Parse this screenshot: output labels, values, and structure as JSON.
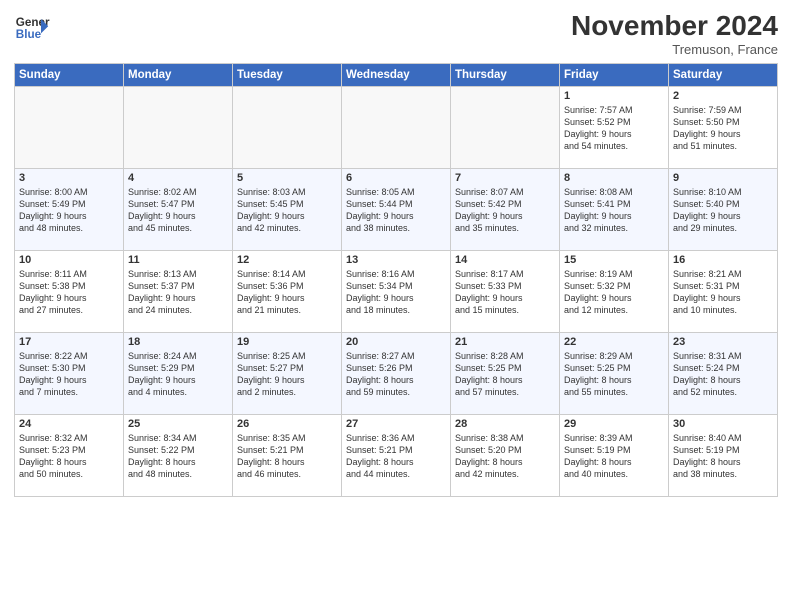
{
  "header": {
    "logo_line1": "General",
    "logo_line2": "Blue",
    "title": "November 2024",
    "location": "Tremuson, France"
  },
  "days_of_week": [
    "Sunday",
    "Monday",
    "Tuesday",
    "Wednesday",
    "Thursday",
    "Friday",
    "Saturday"
  ],
  "weeks": [
    [
      {
        "day": "",
        "info": ""
      },
      {
        "day": "",
        "info": ""
      },
      {
        "day": "",
        "info": ""
      },
      {
        "day": "",
        "info": ""
      },
      {
        "day": "",
        "info": ""
      },
      {
        "day": "1",
        "info": "Sunrise: 7:57 AM\nSunset: 5:52 PM\nDaylight: 9 hours\nand 54 minutes."
      },
      {
        "day": "2",
        "info": "Sunrise: 7:59 AM\nSunset: 5:50 PM\nDaylight: 9 hours\nand 51 minutes."
      }
    ],
    [
      {
        "day": "3",
        "info": "Sunrise: 8:00 AM\nSunset: 5:49 PM\nDaylight: 9 hours\nand 48 minutes."
      },
      {
        "day": "4",
        "info": "Sunrise: 8:02 AM\nSunset: 5:47 PM\nDaylight: 9 hours\nand 45 minutes."
      },
      {
        "day": "5",
        "info": "Sunrise: 8:03 AM\nSunset: 5:45 PM\nDaylight: 9 hours\nand 42 minutes."
      },
      {
        "day": "6",
        "info": "Sunrise: 8:05 AM\nSunset: 5:44 PM\nDaylight: 9 hours\nand 38 minutes."
      },
      {
        "day": "7",
        "info": "Sunrise: 8:07 AM\nSunset: 5:42 PM\nDaylight: 9 hours\nand 35 minutes."
      },
      {
        "day": "8",
        "info": "Sunrise: 8:08 AM\nSunset: 5:41 PM\nDaylight: 9 hours\nand 32 minutes."
      },
      {
        "day": "9",
        "info": "Sunrise: 8:10 AM\nSunset: 5:40 PM\nDaylight: 9 hours\nand 29 minutes."
      }
    ],
    [
      {
        "day": "10",
        "info": "Sunrise: 8:11 AM\nSunset: 5:38 PM\nDaylight: 9 hours\nand 27 minutes."
      },
      {
        "day": "11",
        "info": "Sunrise: 8:13 AM\nSunset: 5:37 PM\nDaylight: 9 hours\nand 24 minutes."
      },
      {
        "day": "12",
        "info": "Sunrise: 8:14 AM\nSunset: 5:36 PM\nDaylight: 9 hours\nand 21 minutes."
      },
      {
        "day": "13",
        "info": "Sunrise: 8:16 AM\nSunset: 5:34 PM\nDaylight: 9 hours\nand 18 minutes."
      },
      {
        "day": "14",
        "info": "Sunrise: 8:17 AM\nSunset: 5:33 PM\nDaylight: 9 hours\nand 15 minutes."
      },
      {
        "day": "15",
        "info": "Sunrise: 8:19 AM\nSunset: 5:32 PM\nDaylight: 9 hours\nand 12 minutes."
      },
      {
        "day": "16",
        "info": "Sunrise: 8:21 AM\nSunset: 5:31 PM\nDaylight: 9 hours\nand 10 minutes."
      }
    ],
    [
      {
        "day": "17",
        "info": "Sunrise: 8:22 AM\nSunset: 5:30 PM\nDaylight: 9 hours\nand 7 minutes."
      },
      {
        "day": "18",
        "info": "Sunrise: 8:24 AM\nSunset: 5:29 PM\nDaylight: 9 hours\nand 4 minutes."
      },
      {
        "day": "19",
        "info": "Sunrise: 8:25 AM\nSunset: 5:27 PM\nDaylight: 9 hours\nand 2 minutes."
      },
      {
        "day": "20",
        "info": "Sunrise: 8:27 AM\nSunset: 5:26 PM\nDaylight: 8 hours\nand 59 minutes."
      },
      {
        "day": "21",
        "info": "Sunrise: 8:28 AM\nSunset: 5:25 PM\nDaylight: 8 hours\nand 57 minutes."
      },
      {
        "day": "22",
        "info": "Sunrise: 8:29 AM\nSunset: 5:25 PM\nDaylight: 8 hours\nand 55 minutes."
      },
      {
        "day": "23",
        "info": "Sunrise: 8:31 AM\nSunset: 5:24 PM\nDaylight: 8 hours\nand 52 minutes."
      }
    ],
    [
      {
        "day": "24",
        "info": "Sunrise: 8:32 AM\nSunset: 5:23 PM\nDaylight: 8 hours\nand 50 minutes."
      },
      {
        "day": "25",
        "info": "Sunrise: 8:34 AM\nSunset: 5:22 PM\nDaylight: 8 hours\nand 48 minutes."
      },
      {
        "day": "26",
        "info": "Sunrise: 8:35 AM\nSunset: 5:21 PM\nDaylight: 8 hours\nand 46 minutes."
      },
      {
        "day": "27",
        "info": "Sunrise: 8:36 AM\nSunset: 5:21 PM\nDaylight: 8 hours\nand 44 minutes."
      },
      {
        "day": "28",
        "info": "Sunrise: 8:38 AM\nSunset: 5:20 PM\nDaylight: 8 hours\nand 42 minutes."
      },
      {
        "day": "29",
        "info": "Sunrise: 8:39 AM\nSunset: 5:19 PM\nDaylight: 8 hours\nand 40 minutes."
      },
      {
        "day": "30",
        "info": "Sunrise: 8:40 AM\nSunset: 5:19 PM\nDaylight: 8 hours\nand 38 minutes."
      }
    ]
  ]
}
